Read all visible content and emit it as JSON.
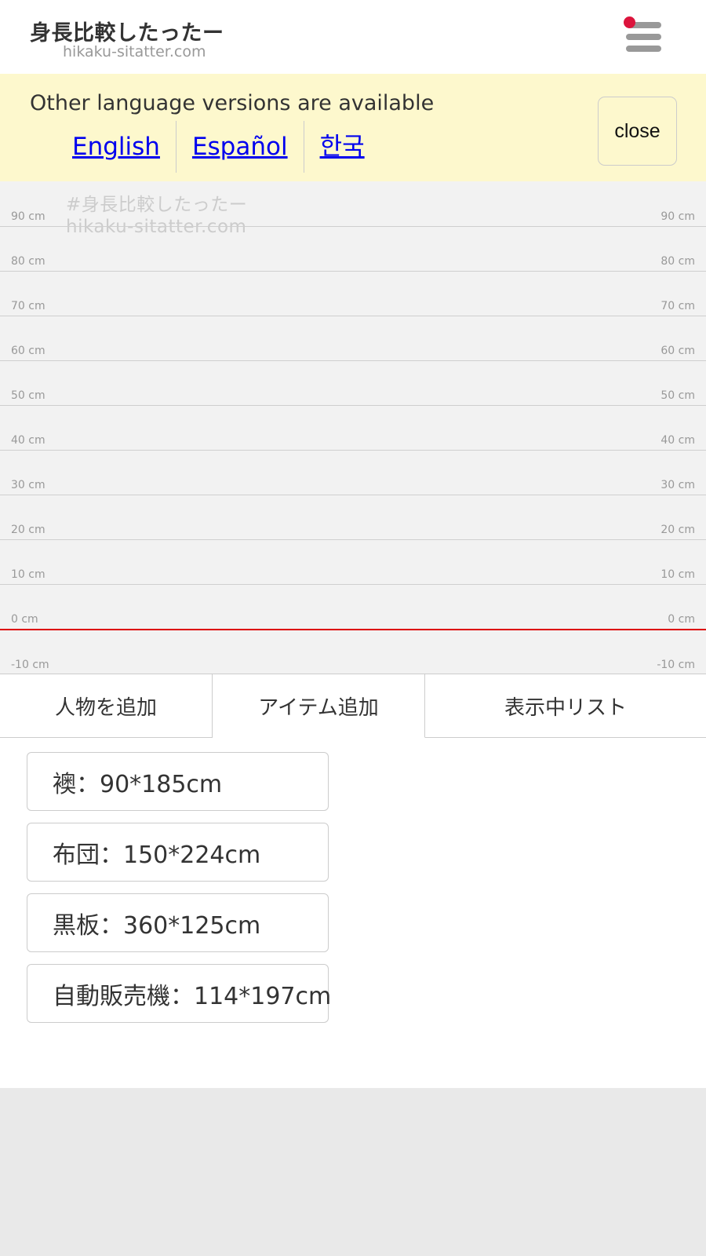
{
  "header": {
    "title": "身長比較したったー",
    "domain": "hikaku-sitatter.com",
    "menu_icon": "hamburger-menu-icon",
    "notification_dot_color": "#dc143c"
  },
  "language_banner": {
    "message": "Other language versions are available",
    "links": [
      {
        "label": "English"
      },
      {
        "label": "Español"
      },
      {
        "label": "한국"
      }
    ],
    "close_label": "close"
  },
  "chart": {
    "watermark_line1": "#身長比較したったー",
    "watermark_line2": "hikaku-sitatter.com",
    "ticks": [
      "90 cm",
      "80 cm",
      "70 cm",
      "60 cm",
      "50 cm",
      "40 cm",
      "30 cm",
      "20 cm",
      "10 cm",
      "0 cm",
      "-10 cm"
    ],
    "baseline_color": "#dd0000"
  },
  "tabs": [
    {
      "label": "人物を追加",
      "active": false
    },
    {
      "label": "アイテム追加",
      "active": true
    },
    {
      "label": "表示中リスト",
      "active": false
    }
  ],
  "items": [
    {
      "label": "襖：90*185cm"
    },
    {
      "label": "布団：150*224cm"
    },
    {
      "label": "黒板：360*125cm"
    },
    {
      "label": "自動販売機：114*197cm"
    }
  ]
}
